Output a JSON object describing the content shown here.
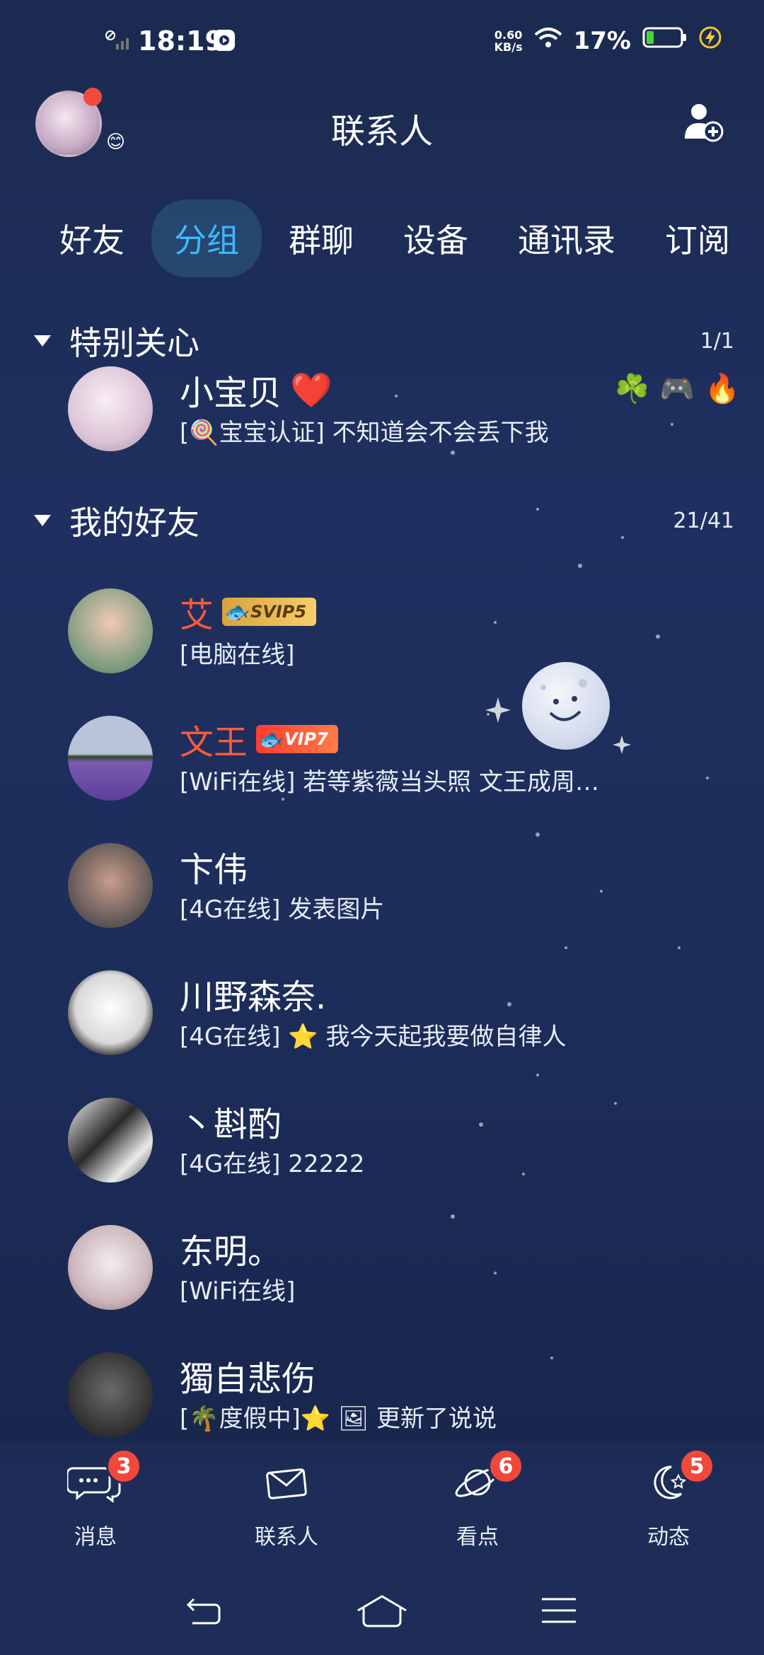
{
  "status_bar": {
    "time": "18:19",
    "net_speed_value": "0.60",
    "net_speed_unit": "KB/s",
    "battery": "17%"
  },
  "header": {
    "title": "联系人",
    "avatar_emoji": "😊"
  },
  "tabs": [
    {
      "label": "好友",
      "active": false
    },
    {
      "label": "分组",
      "active": true
    },
    {
      "label": "群聊",
      "active": false
    },
    {
      "label": "设备",
      "active": false
    },
    {
      "label": "通讯录",
      "active": false
    },
    {
      "label": "订阅",
      "active": false
    }
  ],
  "groups": {
    "special": {
      "title": "特别关心",
      "count": "1/1"
    },
    "friends": {
      "title": "我的好友",
      "count": "21/41"
    }
  },
  "special_contact": {
    "name": "小宝贝",
    "heart": "❤️",
    "status": "[🍭宝宝认证] 不知道会不会丢下我",
    "icons": [
      "☘️",
      "🎮",
      "🔥"
    ]
  },
  "contacts": [
    {
      "name": "艾",
      "badge": "SVIP5",
      "status": "[电脑在线]"
    },
    {
      "name": "文王",
      "badge": "VIP7",
      "status": "[WiFi在线] 若等紫薇当头照    文王成周…"
    },
    {
      "name": "卞伟",
      "status": "[4G在线] 发表图片"
    },
    {
      "name": "川野森奈.",
      "status": "[4G在线] ⭐ 我今天起我要做自律人"
    },
    {
      "name": "丶斟酌",
      "status": "[4G在线] 22222"
    },
    {
      "name": "东明。",
      "status": "[WiFi在线]"
    },
    {
      "name": "獨自悲伤",
      "status": "[🌴度假中]⭐ 🖼 更新了说说"
    }
  ],
  "bottom_nav": [
    {
      "label": "消息",
      "badge": "3",
      "icon": "message-icon"
    },
    {
      "label": "联系人",
      "badge": "",
      "icon": "contacts-icon"
    },
    {
      "label": "看点",
      "badge": "6",
      "icon": "planet-icon"
    },
    {
      "label": "动态",
      "badge": "5",
      "icon": "moon-star-icon"
    }
  ],
  "colors": {
    "accent": "#3fb8ff",
    "badge_red": "#f2483b",
    "vip_name": "#ff5a3a"
  }
}
